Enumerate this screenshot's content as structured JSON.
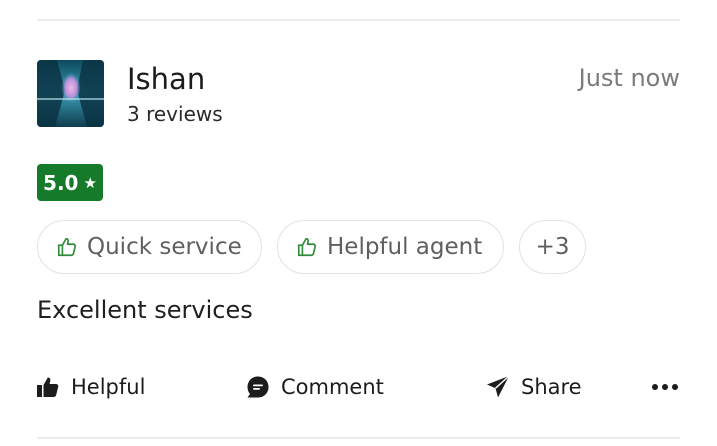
{
  "review": {
    "author_name": "Ishan",
    "author_reviews": "3 reviews",
    "timestamp": "Just now",
    "rating": "5.0",
    "rating_star": "★",
    "tags": [
      "Quick service",
      "Helpful agent",
      "+3"
    ],
    "text": "Excellent services"
  },
  "actions": {
    "helpful": "Helpful",
    "comment": "Comment",
    "share": "Share"
  },
  "colors": {
    "rating_badge": "#167a2b",
    "thumb_icon": "#2e8b3a",
    "chip_border": "#e2e2e2"
  },
  "icons": {
    "tag": "thumbs-up-outline-icon",
    "helpful": "thumbs-up-filled-icon",
    "comment": "comment-bubble-icon",
    "share": "paper-plane-icon",
    "more": "more-dots-icon"
  }
}
